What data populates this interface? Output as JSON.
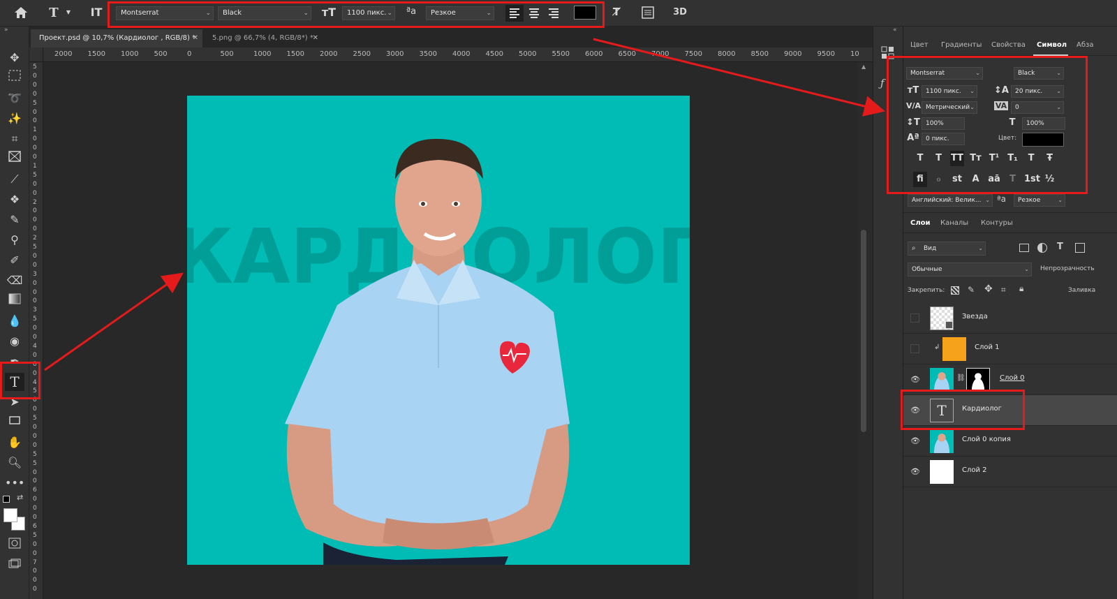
{
  "options_bar": {
    "font_family": "Montserrat",
    "font_style": "Black",
    "font_size": "1100 пикс.",
    "antialias_label": "ªa",
    "antialias": "Резкое",
    "threed_label": "3D",
    "text_color": "#000000"
  },
  "tabs": [
    {
      "label": "Проект.psd @ 10,7% (Кардиолог , RGB/8) *"
    },
    {
      "label": "5.png @ 66,7% (4, RGB/8*) *"
    }
  ],
  "ruler": {
    "horizontal": [
      "2000",
      "1500",
      "1000",
      "500",
      "0",
      "500",
      "1000",
      "1500",
      "2000",
      "2500",
      "3000",
      "3500",
      "4000",
      "4500",
      "5000",
      "5500",
      "6000",
      "6500",
      "7000",
      "7500",
      "8000",
      "8500",
      "9000",
      "9500",
      "10"
    ],
    "vertical": [
      "5",
      "0",
      "0",
      "0",
      "5",
      "0",
      "0",
      "1",
      "0",
      "0",
      "0",
      "1",
      "5",
      "0",
      "0",
      "2",
      "0",
      "0",
      "0",
      "2",
      "5",
      "0",
      "0",
      "3",
      "0",
      "0",
      "0",
      "3",
      "5",
      "0",
      "0",
      "4",
      "0",
      "0",
      "0",
      "4",
      "5",
      "0",
      "0",
      "5",
      "0",
      "0",
      "0",
      "5",
      "5",
      "0",
      "0",
      "6",
      "0",
      "0",
      "0",
      "6",
      "5",
      "0",
      "0",
      "7",
      "0",
      "0",
      "0"
    ]
  },
  "canvas": {
    "bg_color": "#00BCB4",
    "text": "КАРДИОЛОГ",
    "text_color": "#009E97",
    "shirt_color": "#A9D3F2",
    "heart_color": "#E8263C"
  },
  "panel_tabs": [
    "Цвет",
    "Градиенты",
    "Свойства",
    "Символ",
    "Абза"
  ],
  "character": {
    "font_family": "Montserrat",
    "font_style": "Black",
    "size": "1100 пикс.",
    "leading": "20 пикс.",
    "kerning": "Метрический",
    "tracking": "0",
    "vscale": "100%",
    "hscale": "100%",
    "baseline": "0 пикс.",
    "color_label": "Цвет:",
    "color": "#000000",
    "style_buttons": [
      "T",
      "T",
      "TT",
      "Tт",
      "T¹",
      "T₁",
      "T",
      "Ŧ"
    ],
    "opentype_buttons": [
      "fi",
      "ℴ",
      "st",
      "A",
      "aā",
      "T",
      "1st",
      "½"
    ],
    "language": "Английский: Велик...",
    "antialias_label": "ªa",
    "antialias": "Резкое"
  },
  "layers_panel": {
    "tabs": [
      "Слои",
      "Каналы",
      "Контуры"
    ],
    "filter": "Вид",
    "blend_mode": "Обычные",
    "opacity_label": "Непрозрачность",
    "lock_label": "Закрепить:",
    "fill_label": "Заливка",
    "layers": [
      {
        "name": "Звезда",
        "visible": false
      },
      {
        "name": "Слой 1",
        "visible": false
      },
      {
        "name": "Слой 0",
        "visible": true
      },
      {
        "name": "Кардиолог",
        "visible": true
      },
      {
        "name": "Слой 0 копия",
        "visible": true
      },
      {
        "name": "Слой 2",
        "visible": true
      }
    ]
  },
  "annotation_color": "#E51B1B"
}
